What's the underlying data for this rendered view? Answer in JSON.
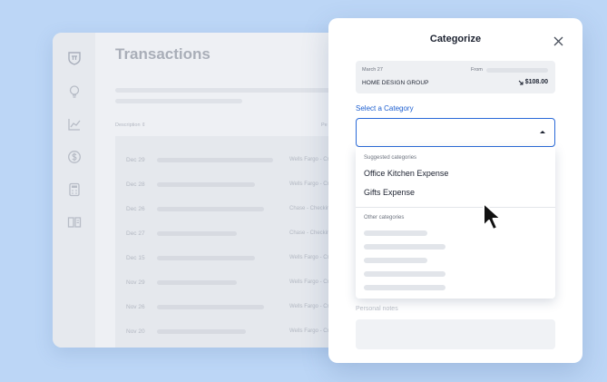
{
  "background_window": {
    "title": "Transactions",
    "column_headers": [
      "Description ⇕",
      "Pe"
    ],
    "transactions": [
      {
        "date": "Dec 29",
        "bank": "Wells Fargo - Cre"
      },
      {
        "date": "Dec 28",
        "bank": "Wells Fargo - Cre"
      },
      {
        "date": "Dec 26",
        "bank": "Chase - Checkin"
      },
      {
        "date": "Dec 27",
        "bank": "Chase - Checkin"
      },
      {
        "date": "Dec 15",
        "bank": "Wells Fargo - Cre"
      },
      {
        "date": "Nov 29",
        "bank": "Wells Fargo - Cre"
      },
      {
        "date": "Nov 26",
        "bank": "Wells Fargo - Cre"
      },
      {
        "date": "Nov 20",
        "bank": "Wells Fargo - Cre"
      }
    ],
    "sidebar_icons": [
      "logo-icon",
      "lightbulb-icon",
      "chart-line-icon",
      "dollar-icon",
      "calculator-icon",
      "book-icon"
    ]
  },
  "dialog": {
    "title": "Categorize",
    "transaction": {
      "date": "March 27",
      "from_label": "From",
      "merchant": "HOME DESIGN GROUP",
      "amount": "$108.00"
    },
    "select_label": "Select a Category",
    "dropdown": {
      "suggested_header": "Suggested categories",
      "suggested": [
        "Office Kitchen Expense",
        "Gifts Expense"
      ],
      "other_header": "Other categories"
    },
    "notes_label": "Personal notes"
  },
  "colors": {
    "background": "#bcd6f6",
    "accent": "#2a6ad8",
    "label_blue": "#1d5fd0"
  }
}
